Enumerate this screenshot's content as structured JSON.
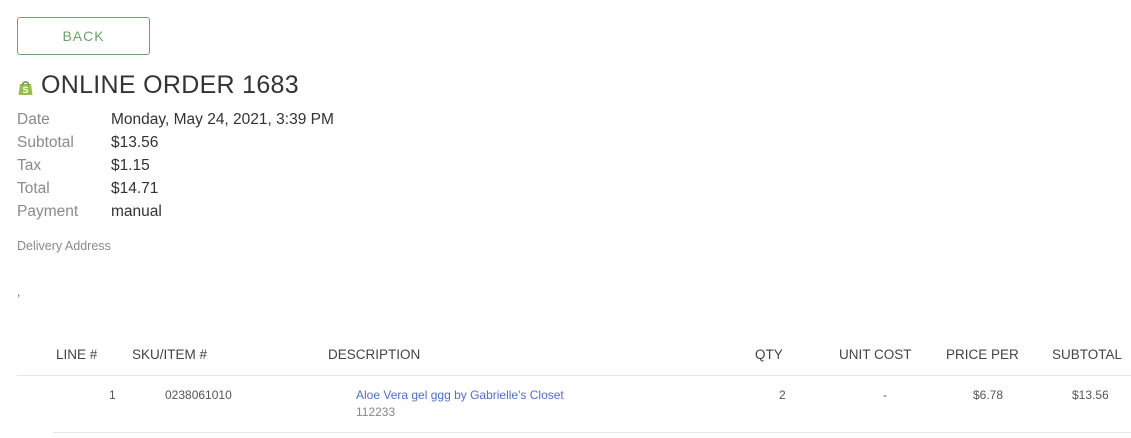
{
  "back_label": "BACK",
  "order": {
    "title": "ONLINE ORDER 1683"
  },
  "info": [
    {
      "label": "Date",
      "value": "Monday, May 24, 2021, 3:39 PM"
    },
    {
      "label": "Subtotal",
      "value": "$13.56"
    },
    {
      "label": "Tax",
      "value": "$1.15"
    },
    {
      "label": "Total",
      "value": "$14.71"
    },
    {
      "label": "Payment",
      "value": "manual"
    }
  ],
  "delivery": {
    "label": "Delivery Address",
    "value": ","
  },
  "table": {
    "headers": [
      "LINE #",
      "SKU/ITEM #",
      "DESCRIPTION",
      "QTY",
      "UNIT COST",
      "PRICE PER",
      "SUBTOTAL"
    ],
    "rows": [
      {
        "line": "1",
        "sku": "0238061010",
        "description": "Aloe Vera gel ggg by Gabrielle's Closet",
        "description_sub": "112233",
        "qty": "2",
        "unit_cost": "-",
        "price_per": "$6.78",
        "subtotal": "$13.56"
      }
    ]
  },
  "colors": {
    "accent": "#6aa56a",
    "link": "#4f6fd1",
    "shopify_green": "#95bf47"
  },
  "icons": {
    "title_icon": "shopify-bag-icon"
  }
}
